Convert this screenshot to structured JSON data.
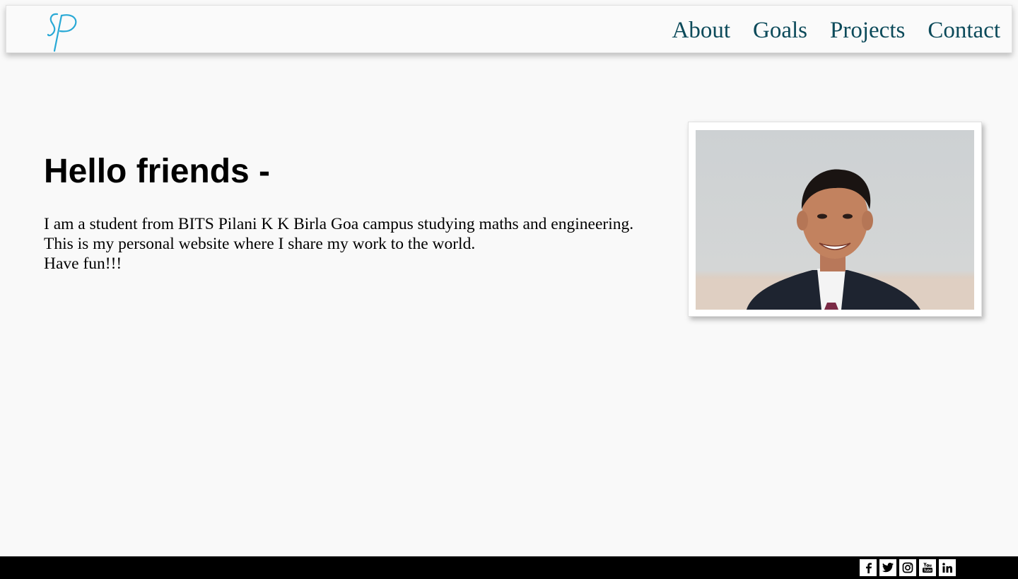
{
  "header": {
    "logo_text": "SP",
    "nav": [
      {
        "label": "About"
      },
      {
        "label": "Goals"
      },
      {
        "label": "Projects"
      },
      {
        "label": "Contact"
      }
    ]
  },
  "hero": {
    "heading": "Hello friends -",
    "lines": [
      "I am a student from BITS Pilani K K Birla Goa campus studying maths and engineering.",
      "This is my personal website where I share my work to the world.",
      "Have fun!!!"
    ]
  },
  "photo": {
    "icon": "profile-photo"
  },
  "footer": {
    "social_icons": [
      "facebook-icon",
      "twitter-icon",
      "instagram-icon",
      "youtube-icon",
      "linkedin-icon"
    ]
  },
  "colors": {
    "background": "#f9f9f9",
    "nav_text": "#0c4a5a",
    "logo": "#29a9d6",
    "footer": "#000000"
  }
}
